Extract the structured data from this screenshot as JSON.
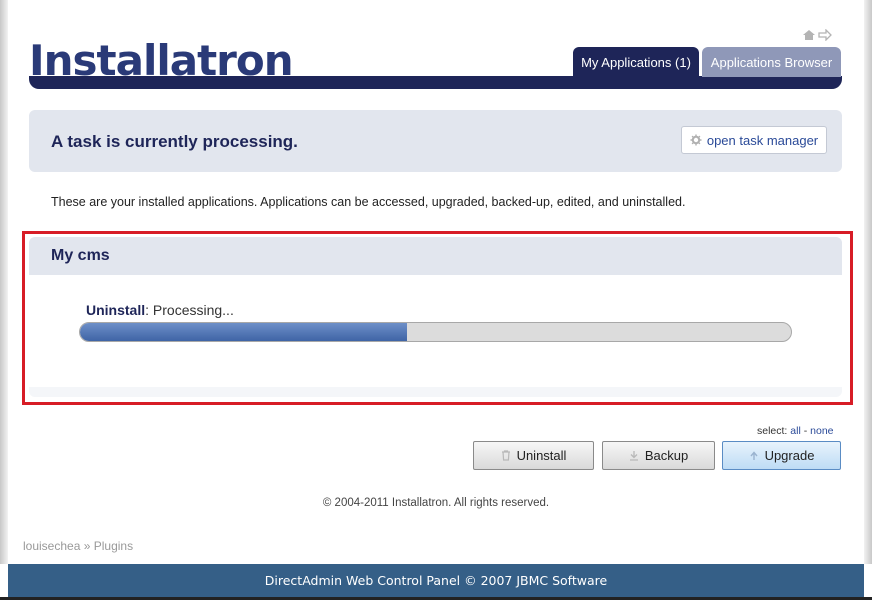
{
  "header": {
    "logo_text": "Installatron",
    "tabs": [
      {
        "label": "My Applications (1)",
        "active": true
      },
      {
        "label": "Applications Browser",
        "active": false
      }
    ],
    "icons": [
      "home-icon",
      "arrow-icon"
    ]
  },
  "task": {
    "title": "A task is currently processing.",
    "button_label": "open task manager",
    "button_icon": "gear-icon"
  },
  "intro_text": "These are your installed applications. Applications can be accessed, upgraded, backed-up, edited, and uninstalled.",
  "app": {
    "name": "My cms",
    "action": "Uninstall",
    "status": ": Processing...",
    "progress_percent": 46
  },
  "select": {
    "label": "select:",
    "all": "all",
    "separator": "-",
    "none": "none"
  },
  "actions": {
    "uninstall": "Uninstall",
    "backup": "Backup",
    "upgrade": "Upgrade"
  },
  "copyright": "© 2004-2011 Installatron. All rights reserved.",
  "breadcrumb": {
    "user": "louisechea",
    "separator": "»",
    "page": "Plugins"
  },
  "footer": "DirectAdmin Web Control Panel © 2007 JBMC Software",
  "colors": {
    "brand_navy": "#1e2558",
    "panel_bg": "#e2e6ee",
    "highlight_border": "#d71c26",
    "progress_fill": "#3f64a6",
    "footer_bg": "#355f87"
  }
}
